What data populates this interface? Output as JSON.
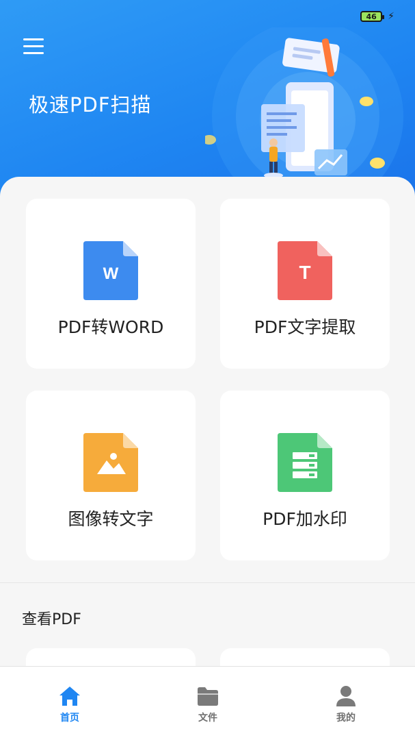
{
  "status_bar": {
    "battery": "46",
    "battery_color": "#9be35e"
  },
  "header": {
    "title": "极速PDF扫描",
    "background_color": "#1f86f2"
  },
  "tools": [
    {
      "label": "PDF转WORD",
      "icon": "word-file-icon",
      "icon_letter": "W",
      "color": "#3d8bef"
    },
    {
      "label": "PDF文字提取",
      "icon": "text-file-icon",
      "icon_letter": "T",
      "color": "#f0625e"
    },
    {
      "label": "图像转文字",
      "icon": "image-file-icon",
      "color": "#f6ab3b"
    },
    {
      "label": "PDF加水印",
      "icon": "sheet-file-icon",
      "color": "#4dc777"
    }
  ],
  "view_section": {
    "title": "查看PDF"
  },
  "bottom_nav": {
    "items": [
      {
        "label": "首页",
        "icon": "home-icon",
        "active": true
      },
      {
        "label": "文件",
        "icon": "folder-icon",
        "active": false
      },
      {
        "label": "我的",
        "icon": "user-icon",
        "active": false
      }
    ],
    "active_color": "#1f86f2",
    "inactive_color": "#6f6f6f"
  }
}
